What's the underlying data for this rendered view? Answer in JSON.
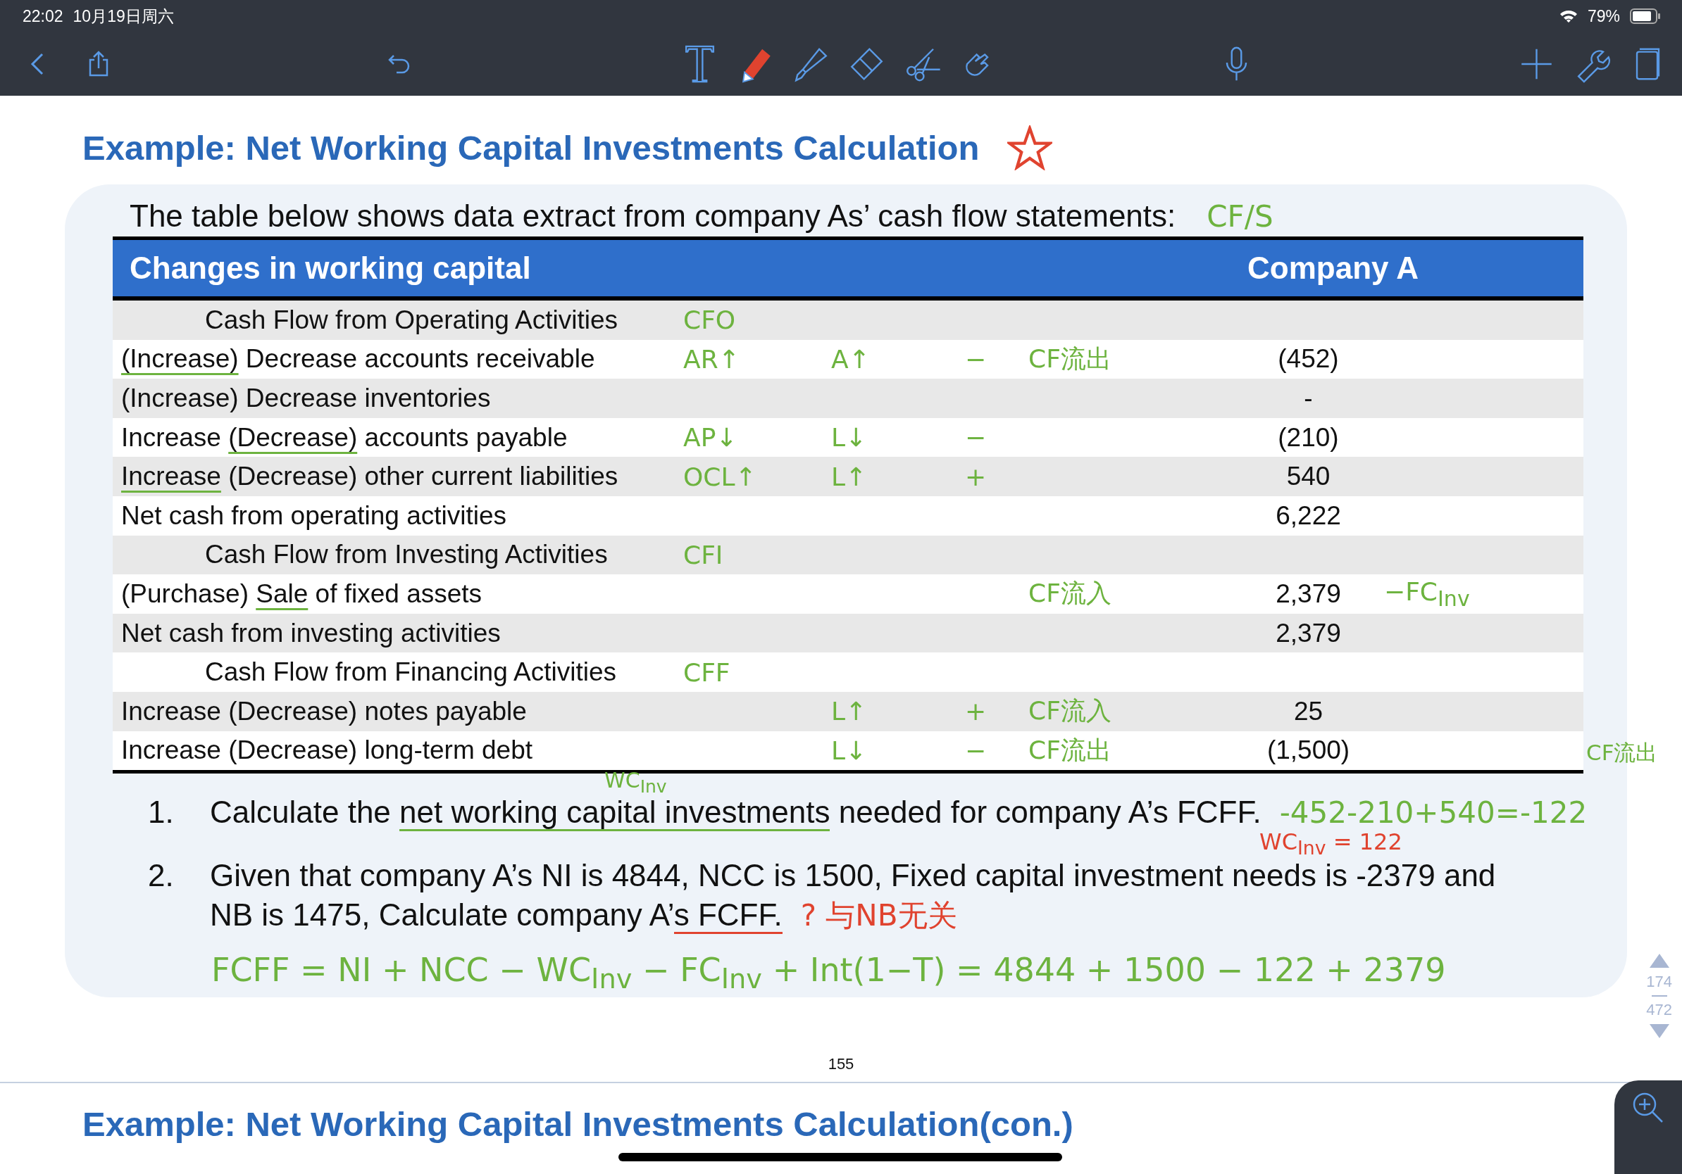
{
  "status_bar": {
    "time": "22:02",
    "date": "10月19日周六",
    "battery": "79%"
  },
  "slide": {
    "title": "Example: Net Working Capital Investments Calculation",
    "intro": "The table below shows data extract from company As’ cash flow statements:",
    "intro_note": "CF/S",
    "table": {
      "columns": [
        "Changes in working capital",
        "Company A"
      ],
      "rows": [
        {
          "kind": "section",
          "parts": [
            {
              "text": "Cash Flow from Operating Activities",
              "underline": false
            }
          ],
          "value": "",
          "tag": "CFO"
        },
        {
          "kind": "item",
          "parts": [
            {
              "text": "(Increase)",
              "underline": true
            },
            {
              "text": " Decrease accounts receivable",
              "underline": false
            }
          ],
          "value": "(452)",
          "tag": "AR↑",
          "effect": "A↑",
          "sign": "−",
          "cash_flow": "CF流出"
        },
        {
          "kind": "item",
          "parts": [
            {
              "text": "(Increase) Decrease inventories",
              "underline": false
            }
          ],
          "value": "-"
        },
        {
          "kind": "item",
          "parts": [
            {
              "text": "Increase ",
              "underline": false
            },
            {
              "text": "(Decrease)",
              "underline": true
            },
            {
              "text": " accounts payable",
              "underline": false
            }
          ],
          "value": "(210)",
          "tag": "AP↓",
          "effect": "L↓",
          "sign": "−"
        },
        {
          "kind": "item",
          "parts": [
            {
              "text": "Increase",
              "underline": true
            },
            {
              "text": " (Decrease) other current liabilities",
              "underline": false
            }
          ],
          "value": "540",
          "tag": "OCL↑",
          "effect": "L↑",
          "sign": "+"
        },
        {
          "kind": "item",
          "parts": [
            {
              "text": "Net cash from operating activities",
              "underline": false
            }
          ],
          "value": "6,222"
        },
        {
          "kind": "section",
          "parts": [
            {
              "text": "Cash Flow from Investing Activities",
              "underline": false
            }
          ],
          "value": "",
          "tag": "CFI"
        },
        {
          "kind": "item",
          "parts": [
            {
              "text": "(Purchase) ",
              "underline": false
            },
            {
              "text": "Sale",
              "underline": true
            },
            {
              "text": " of fixed assets",
              "underline": false
            }
          ],
          "value": "2,379",
          "cash_flow": "CF流入",
          "side_note": "−FC$_{Inv}$"
        },
        {
          "kind": "item",
          "parts": [
            {
              "text": "Net cash from investing activities",
              "underline": false
            }
          ],
          "value": "2,379"
        },
        {
          "kind": "section",
          "parts": [
            {
              "text": "Cash Flow from Financing Activities",
              "underline": false
            }
          ],
          "value": "",
          "tag": "CFF"
        },
        {
          "kind": "item",
          "parts": [
            {
              "text": "Increase (Decrease) notes payable",
              "underline": false
            }
          ],
          "value": "25",
          "effect": "L↑",
          "sign": "+",
          "cash_flow": "CF流入"
        },
        {
          "kind": "item",
          "parts": [
            {
              "text": "Increase (Decrease) long-term debt",
              "underline": false
            }
          ],
          "value": "(1,500)",
          "effect": "L↓",
          "sign": "−",
          "cash_flow": "CF流出",
          "margin_note": "CF流出"
        }
      ]
    },
    "questions": [
      {
        "number": "1.",
        "lines": [
          [
            {
              "text": "Calculate the "
            },
            {
              "text": "net working capital investments",
              "underline": true,
              "color": "#6db33f"
            },
            {
              "text": " needed for company A’s FCFF."
            }
          ]
        ],
        "above_note": "WC$_{Inv}$",
        "note": "-452-210+540=-122",
        "below_note": "WC$_{Inv}$ = 122"
      },
      {
        "number": "2.",
        "lines": [
          [
            {
              "text": "Given that company A’s NI is 4844, NCC is 1500, Fixed capital investment needs is -2379 and"
            }
          ],
          [
            {
              "text": "NB is 1475, Calculate company A’"
            },
            {
              "text": "s FCFF.",
              "underline": true,
              "color": "#e0432f"
            }
          ]
        ],
        "note": "?  与NB无关"
      }
    ],
    "formula": "FCFF = NI + NCC − WC$_{Inv}$ − FC$_{Inv}$ + Int(1−T) = 4844 + 1500 − 122 + 2379"
  },
  "page_number": "155",
  "page_indicator": {
    "current": "174",
    "total": "472"
  },
  "next_slide": {
    "title": "Example: Net Working Capital Investments Calculation(con.)"
  }
}
